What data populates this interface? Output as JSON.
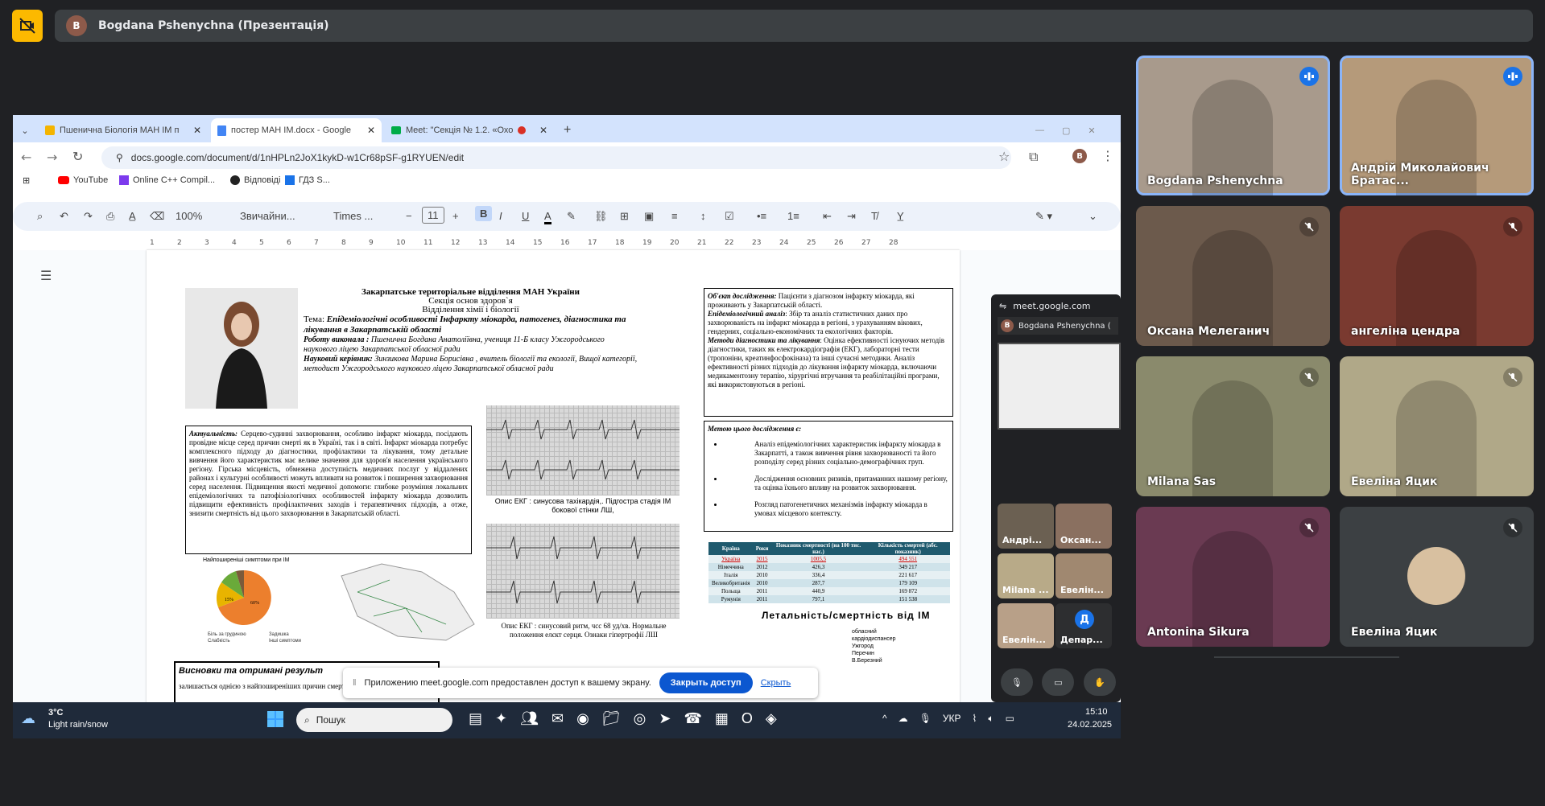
{
  "presenter_bar": {
    "avatar": "B",
    "label": "Bogdana Pshenychna (Презентація)"
  },
  "browser": {
    "tabs": [
      {
        "label": "Пшенична Біологія МАН ІМ п",
        "favicon": "slides-icon"
      },
      {
        "label": "постер МАН ІМ.docx - Google",
        "favicon": "docs-icon"
      },
      {
        "label": "Meet: \"Секція № 1.2. «Охо",
        "favicon": "meet-icon"
      }
    ],
    "url": "docs.google.com/document/d/1nHPLn2JoX1kykD-w1Cr68pSF-g1RYUEN/edit",
    "profile": "B",
    "bookmarks": [
      "YouTube",
      "Online C++ Compil...",
      "Відповіді",
      "ГДЗ S..."
    ]
  },
  "doc_toolbar": {
    "zoom": "100%",
    "style": "Звичайни...",
    "font": "Times ...",
    "size": "11"
  },
  "ruler_ticks": [
    "1",
    "2",
    "3",
    "4",
    "5",
    "6",
    "7",
    "8",
    "9",
    "10",
    "11",
    "12",
    "13",
    "14",
    "15",
    "16",
    "17",
    "18",
    "19",
    "20",
    "21",
    "22",
    "23",
    "24",
    "25",
    "26",
    "27",
    "28"
  ],
  "poster": {
    "header_lines": [
      "Закарпатське територіальне відділення МАН України",
      "Секція основ здоров`я",
      "Відділення хімії і біології"
    ],
    "topic_label": "Тема: ",
    "topic": "Епідеміологічні особливості Інфаркту міокарда, патогенез, діагностика та лікування в Закарпатській області",
    "author_label": "Роботу виконала : ",
    "author": "Пшенична Богдана Анатоліївна, учениця 11-Б класу Ужгородського наукового ліцею Закарпатської обласної ради",
    "supervisor_label": "Науковий керівник: ",
    "supervisor": "Зинзикова Марина Борисівна , вчитель біології та екології, Вищої категорії, методист Ужгородського наукового ліцею Закарпатської обласної ради",
    "relevance_title": "Актуальність:",
    "relevance": "Серцево-судинні захворювання, особливо інфаркт міокарда, посідають провідне місце серед причин смерті як в Україні, так і в світі. Інфаркт міокарда потребує комплексного підходу до діагностики, профілактики та лікування, тому детальне вивчення його характеристик має велике значення для здоров'я населення українського регіону. Гірська місцевість, обмежена доступність медичних послуг у віддалених районах і культурні особливості можуть впливати на розвиток і поширення захворювання серед населення. Підвищення якості медичної допомоги: глибоке розуміння локальних епідеміологічних та патофізіологічних особливостей інфаркту міокарда дозволить підвищити ефективність профілактичних заходів і терапевтичних підходів, а отже, знизити смертність від цього захворювання в Закарпатській області.",
    "pie_title": "Найпоширеніші симптоми при ІМ",
    "pie_labels": [
      "15%",
      "60%"
    ],
    "pie_legend": [
      "Біль за грудиною",
      "Задишка",
      "Слабкість",
      "Інші симптоми"
    ],
    "ecg1_caption": "Опис ЕКГ : синусова тахікардія,. Підгостра стадія ІМ бокової стінки ЛШ,",
    "ecg2_caption": "Опис ЕКГ : синусовий ритм, чсс 68 уд/хв. Нормальне положення елєкт серця. Ознаки гіпертрофії ЛШ",
    "object_title": "Об'єкт дослідження:",
    "object": "Пацієнти з діагнозом інфаркту міокарда, які проживають у Закарпатській області.",
    "subject_title": "Епідеміологічний аналіз",
    "subject": ": Збір та аналіз статистичних даних про захворюваність на інфаркт міокарда в регіоні, з урахуванням вікових, гендерних, соціально-економічних та екологічних факторів.",
    "methods_title": "Методи діагностики та лікування",
    "methods": ": Оцінка ефективності існуючих методів діагностики, таких як електрокардіографія (ЕКГ), лабораторні тести (тропоніни, креатинфосфокіназа) та інші сучасні методики. Аналіз ефективності різних підходів до лікування інфаркту міокарда, включаючи медикаментозну терапію, хірургічні втручання та реабілітаційні програми, які використовуються в регіоні.",
    "goal_title": "Метою цього дослідження є:",
    "goals": [
      "Аналіз епідеміологічних характеристик інфаркту міокарда в Закарпатті, а також вивчення рівня захворюваності та його розподілу серед різних соціально-демографічних груп.",
      "Дослідження основних ризиків, притаманних нашому регіону, та оцінка їхнього впливу на розвиток захворювання.",
      "Розгляд патогенетичних механізмів інфаркту міокарда в умовах місцевого контексту."
    ],
    "table_headers": [
      "Країна",
      "Роки",
      "Показник смертності (на 100 тис. нас.)",
      "Кількість смертей (абс. показник)"
    ],
    "table_rows": [
      [
        "Україна",
        "2015",
        "1005,5",
        "494 551"
      ],
      [
        "Німеччина",
        "2012",
        "426,3",
        "349 217"
      ],
      [
        "Італія",
        "2010",
        "336,4",
        "221 617"
      ],
      [
        "Великобританія",
        "2010",
        "287,7",
        "179 109"
      ],
      [
        "Польща",
        "2011",
        "440,9",
        "169 872"
      ],
      [
        "Румунія",
        "2011",
        "797,1",
        "151 538"
      ]
    ],
    "mortality_title": "Летальність/смертність від ІМ",
    "mortality_legend": [
      "обласний",
      "кардіодиспансер",
      "Ужгород",
      "Перечин",
      "В.Березний"
    ],
    "conclusions_title": "Висновки та отримані результ",
    "conclusions_text": "залишається однією з найпоширеніших причин смертності в світі та в Україні. Мо"
  },
  "share_notice": {
    "text": "Приложению meet.google.com предоставлен доступ к вашему экрану.",
    "close_button": "Закрыть доступ",
    "hide_link": "Скрыть"
  },
  "meet_panel": {
    "url": "meet.google.com",
    "presenter": "Bogdana Pshenychna (",
    "thumbs": [
      "Андрі...",
      "Оксан...",
      "Milana ...",
      "Евелін...",
      "Евелін...",
      "Депар..."
    ],
    "dep_avatar": "Д"
  },
  "taskbar": {
    "temp": "3°C",
    "weather": "Light rain/snow",
    "search": "Пошук",
    "lang": "УКР",
    "time": "15:10",
    "date": "24.02.2025"
  },
  "participants": [
    {
      "name": "Bogdana Pshenychna",
      "speaking": true,
      "bg": "#a89a8c"
    },
    {
      "name": "Андрій Миколайович Братас...",
      "speaking": true,
      "bg": "#b59a7a"
    },
    {
      "name": "Оксана Мелеганич",
      "speaking": false,
      "bg": "#6c5a4c"
    },
    {
      "name": "ангеліна цендра",
      "speaking": false,
      "bg": "#7a3a30"
    },
    {
      "name": "Milana Sas",
      "speaking": false,
      "bg": "#8a8a6c"
    },
    {
      "name": "Евеліна Яцик",
      "speaking": false,
      "bg": "#b0a888"
    },
    {
      "name": "Antonina Sikura",
      "speaking": false,
      "bg": "#6a3a52"
    },
    {
      "name": "Евеліна Яцик",
      "speaking": false,
      "bg": "#3c4043",
      "avatar_only": true
    }
  ]
}
